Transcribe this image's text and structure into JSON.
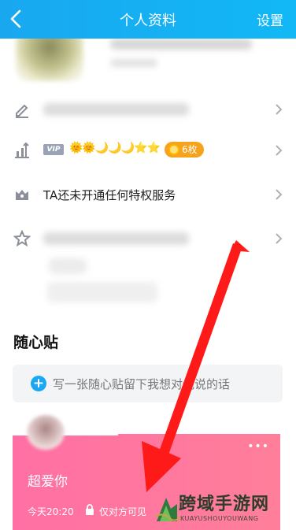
{
  "header": {
    "title": "个人资料",
    "settings_label": "设置"
  },
  "rows": {
    "vip": {
      "badge": "VIP",
      "levels": "🌞🌞🌙🌙🌙⭐⭐",
      "coins": "6枚"
    },
    "privilege": {
      "text": "TA还未开通任何特权服务"
    }
  },
  "note_section": {
    "title": "随心贴",
    "input_hint": "写一张随心贴留下我想对他说的话",
    "plus": "+"
  },
  "card": {
    "message": "超爱你",
    "time": "今天20:20",
    "privacy": "仅对方可见",
    "more": "•••"
  },
  "watermark": {
    "title": "跨域手游网",
    "subtitle": "KUAYUSHOUYOUWANG"
  },
  "colors": {
    "header": "#19a8f0",
    "accent": "#1aa7f3",
    "card": "#ff6fa4",
    "arrow": "#ff1a1a",
    "coin": "#f7a21b"
  }
}
